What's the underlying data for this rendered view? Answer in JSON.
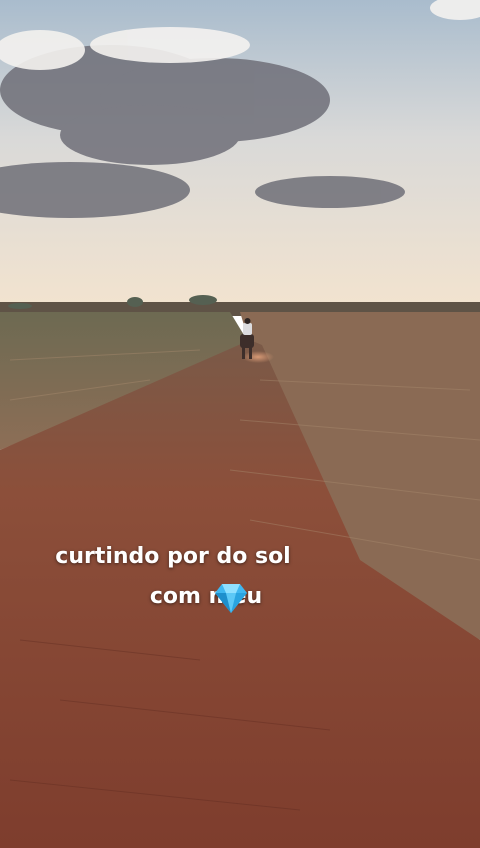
{
  "story": {
    "caption": {
      "line1": "curtindo por do sol",
      "line2": "com meu"
    },
    "sticker": "gem-stone-icon"
  },
  "colors": {
    "sky_top": "#aebfcf",
    "sky_horizon": "#f1e2cf",
    "soil": "#8a4a36",
    "gem": "#3fb7f0"
  }
}
